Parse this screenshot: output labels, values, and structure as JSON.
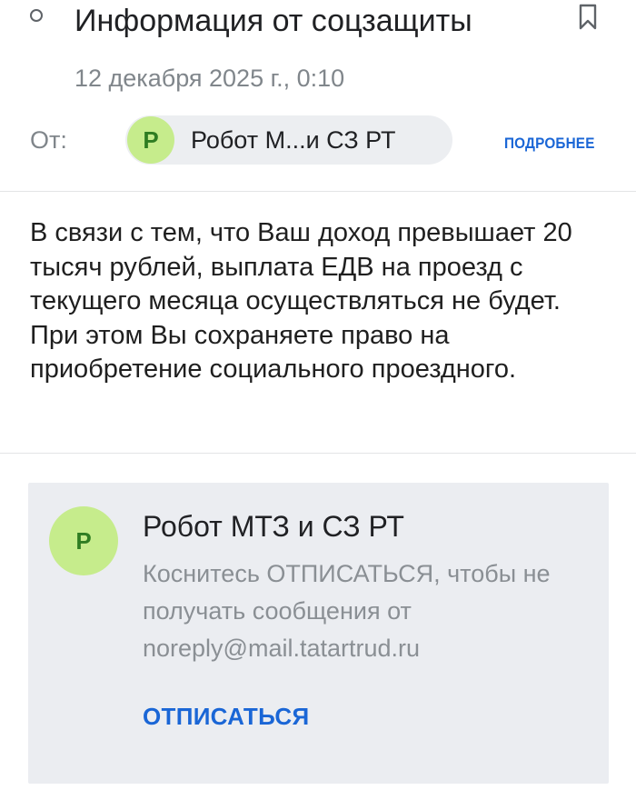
{
  "header": {
    "subject": "Информация от соцзащиты",
    "date": "12 декабря 2025 г., 0:10",
    "bookmark_icon": "bookmark-icon",
    "unread_icon": "unread-dot-icon"
  },
  "from": {
    "label": "От:",
    "sender_initial": "Р",
    "sender_short": "Робот М...и СЗ РТ",
    "details_link": "ПОДРОБНЕЕ"
  },
  "body": {
    "text": "В связи с тем, что Ваш доход превышает 20 тысяч рублей, выплата ЕДВ на проезд с текущего месяца осуществляться не будет. При этом Вы сохраняете право на приобретение социального проездного."
  },
  "unsubscribe": {
    "avatar_initial": "Р",
    "sender_full": "Робот МТЗ и СЗ РТ",
    "hint": "Коснитесь ОТПИСАТЬСЯ, чтобы не получать сообщения от noreply@mail.tatartrud.ru",
    "button_label": "ОТПИСАТЬСЯ"
  },
  "colors": {
    "accent_link": "#1a66d6",
    "avatar_bg": "#c6ec8c",
    "avatar_fg": "#2f7d22",
    "chip_bg": "#eceef1",
    "card_bg": "#ebedf1",
    "muted_text": "#80868b"
  }
}
